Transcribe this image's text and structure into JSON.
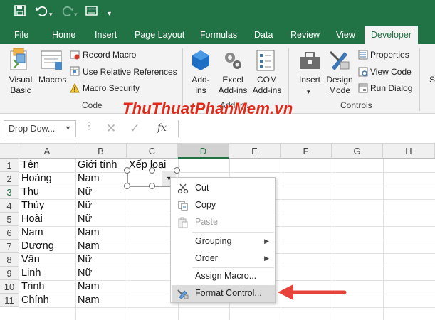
{
  "quick_access": {
    "save_icon": "save-icon",
    "undo_icon": "undo-icon",
    "redo_icon": "redo-icon",
    "form_icon": "form-icon",
    "customize_icon": "customize-icon"
  },
  "tabs": [
    "File",
    "Home",
    "Insert",
    "Page Layout",
    "Formulas",
    "Data",
    "Review",
    "View",
    "Developer"
  ],
  "active_tab": "Developer",
  "ribbon": {
    "code": {
      "visual_basic_line1": "Visual",
      "visual_basic_line2": "Basic",
      "macros": "Macros",
      "record_macro": "Record Macro",
      "use_relative_references": "Use Relative References",
      "macro_security": "Macro Security",
      "group_label": "Code"
    },
    "addins": {
      "addins_line1": "Add-",
      "addins_line2": "ins",
      "excel_addins_line1": "Excel",
      "excel_addins_line2": "Add-ins",
      "com_addins_line1": "COM",
      "com_addins_line2": "Add-ins",
      "group_label": "Add-ins"
    },
    "controls": {
      "insert": "Insert",
      "design_mode_line1": "Design",
      "design_mode_line2": "Mode",
      "properties": "Properties",
      "view_code": "View Code",
      "run_dialog": "Run Dialog",
      "group_label": "Controls"
    },
    "overflow": "S"
  },
  "watermark": "ThuThuatPhanMem.vn",
  "formula_bar": {
    "name_box": "Drop Dow...",
    "fx": "fx",
    "value": ""
  },
  "columns": [
    "A",
    "B",
    "C",
    "D",
    "E",
    "F",
    "G",
    "H"
  ],
  "selected_column": "D",
  "rows": [
    "1",
    "2",
    "3",
    "4",
    "5",
    "6",
    "7",
    "8",
    "9",
    "10",
    "11"
  ],
  "cells": {
    "A": [
      "Tên",
      "Hoàng",
      "Thu",
      "Thủy",
      "Hoài",
      "Nam",
      "Dương",
      "Vân",
      "Linh",
      "Trinh",
      "Chính"
    ],
    "B": [
      "Giới tính",
      "Nam",
      "Nữ",
      "Nữ",
      "Nữ",
      "Nam",
      "Nam",
      "Nữ",
      "Nữ",
      "Nam",
      "Nam"
    ],
    "C1": "Xếp loại"
  },
  "context_menu": {
    "items": [
      {
        "label": "Cut",
        "icon": "scissors-icon",
        "enabled": true
      },
      {
        "label": "Copy",
        "icon": "copy-icon",
        "enabled": true
      },
      {
        "label": "Paste",
        "icon": "paste-icon",
        "enabled": false
      },
      {
        "label": "Grouping",
        "submenu": true,
        "enabled": true
      },
      {
        "label": "Order",
        "submenu": true,
        "enabled": true
      },
      {
        "label": "Assign Macro...",
        "enabled": true
      },
      {
        "label": "Format Control...",
        "icon": "format-control-icon",
        "enabled": true,
        "highlighted": true
      }
    ]
  },
  "colors": {
    "excel_green": "#217346",
    "arrow_red": "#e8433a",
    "watermark_red": "#e02a1a"
  }
}
